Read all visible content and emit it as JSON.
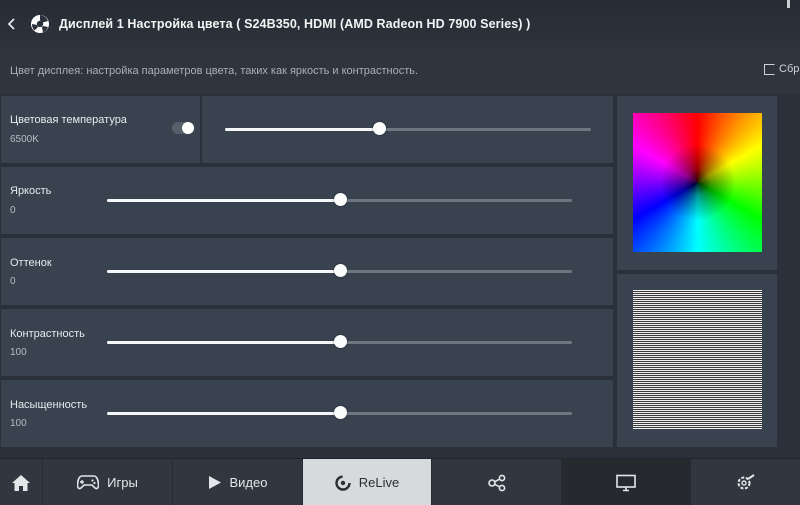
{
  "header": {
    "back_icon": "chevron-left-icon",
    "title": "Дисплей 1 Настройка цвета ( S24B350, HDMI (AMD Radeon HD 7900 Series) )"
  },
  "subheader": {
    "description": "Цвет дисплея: настройка параметров цвета, таких как яркость и контрастность.",
    "reset_label": "Сбр"
  },
  "settings": [
    {
      "label": "Цветовая температура",
      "value": "6500K",
      "slider_fraction": 0.42,
      "toggle_on": true
    },
    {
      "label": "Яркость",
      "value": "0",
      "slider_fraction": 0.5
    },
    {
      "label": "Оттенок",
      "value": "0",
      "slider_fraction": 0.5
    },
    {
      "label": "Контрастность",
      "value": "100",
      "slider_fraction": 0.5
    },
    {
      "label": "Насыщенность",
      "value": "100",
      "slider_fraction": 0.5
    }
  ],
  "tabs": [
    {
      "icon": "home-icon"
    },
    {
      "icon": "gamepad-icon",
      "label": "Игры"
    },
    {
      "icon": "play-icon",
      "label": "Видео"
    },
    {
      "icon": "relive-icon",
      "label": "ReLive",
      "active": true
    },
    {
      "icon": "share-icon"
    },
    {
      "icon": "monitor-icon"
    },
    {
      "icon": "settings-wrench-icon"
    }
  ],
  "colors": {
    "accent_active_tab": "#d7dadc",
    "panel": "#394350",
    "background": "#2a313a"
  }
}
